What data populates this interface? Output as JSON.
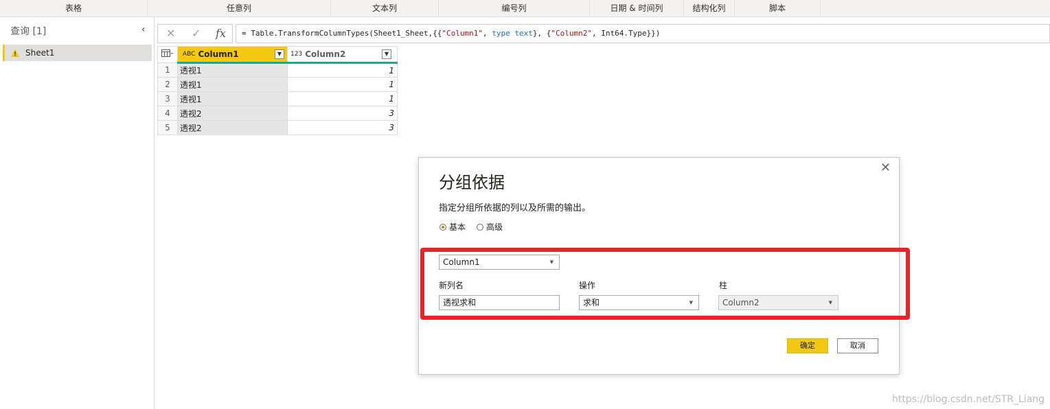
{
  "ribbon": {
    "groups": [
      "表格",
      "任意列",
      "文本列",
      "编号列",
      "日期 & 时间列",
      "结构化列",
      "脚本"
    ]
  },
  "queries": {
    "title": "查询 [1]",
    "items": [
      {
        "label": "Sheet1",
        "warning": true
      }
    ]
  },
  "formula": {
    "prefix": "= Table.TransformColumnTypes(Sheet1_Sheet,{{",
    "s1": "\"Column1\"",
    "t1a": ", ",
    "kw1": "type",
    "t1b": " ",
    "kw2": "text",
    "t1c": "}, {",
    "s2": "\"Column2\"",
    "suffix": ", Int64.Type}})"
  },
  "grid": {
    "columns": [
      {
        "type_icon": "ABC",
        "name": "Column1"
      },
      {
        "type_icon": "123",
        "name": "Column2"
      }
    ],
    "rows": [
      {
        "n": "1",
        "c1": "透视1",
        "c2": "1"
      },
      {
        "n": "2",
        "c1": "透视1",
        "c2": "1"
      },
      {
        "n": "3",
        "c1": "透视1",
        "c2": "1"
      },
      {
        "n": "4",
        "c1": "透视2",
        "c2": "3"
      },
      {
        "n": "5",
        "c1": "透视2",
        "c2": "3"
      }
    ]
  },
  "dialog": {
    "title": "分组依据",
    "description": "指定分组所依据的列以及所需的输出。",
    "radio_basic": "基本",
    "radio_advanced": "高级",
    "group_by_value": "Column1",
    "new_col_label": "新列名",
    "new_col_value": "透视求和",
    "op_label": "操作",
    "op_value": "求和",
    "col_label": "柱",
    "col_value": "Column2",
    "ok": "确定",
    "cancel": "取消"
  },
  "watermark": "https://blog.csdn.net/STR_Liang",
  "colors": {
    "accent": "#f2c811",
    "highlight_box": "#e8242b",
    "teal": "#21a58c"
  }
}
